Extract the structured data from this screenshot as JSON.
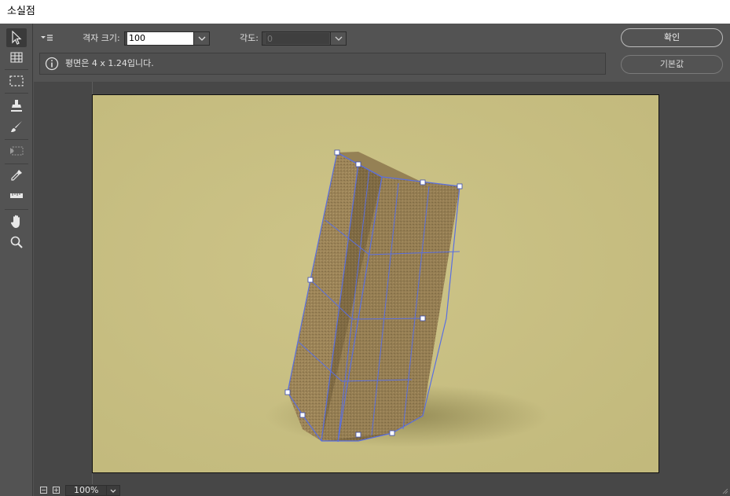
{
  "window": {
    "title": "소실점"
  },
  "options": {
    "grid_size_label": "격자 크기:",
    "grid_size_value": "100",
    "angle_label": "각도:",
    "angle_value": "0",
    "info_text": "평면은 4 x 1.24입니다."
  },
  "buttons": {
    "ok": "확인",
    "default": "기본값"
  },
  "status": {
    "zoom": "100%",
    "zoom_out": "−",
    "zoom_in": "+"
  },
  "tools": [
    "edit-plane-tool-icon",
    "create-plane-tool-icon",
    "marquee-tool-icon",
    "stamp-tool-icon",
    "brush-tool-icon",
    "transform-tool-icon",
    "eyedropper-tool-icon",
    "measure-tool-icon",
    "hand-tool-icon",
    "zoom-tool-icon"
  ],
  "colors": {
    "panel": "#535353",
    "canvas_background": "#c6bd7f",
    "grid_line": "#5a6fe0",
    "box_face": "#9c8458"
  }
}
